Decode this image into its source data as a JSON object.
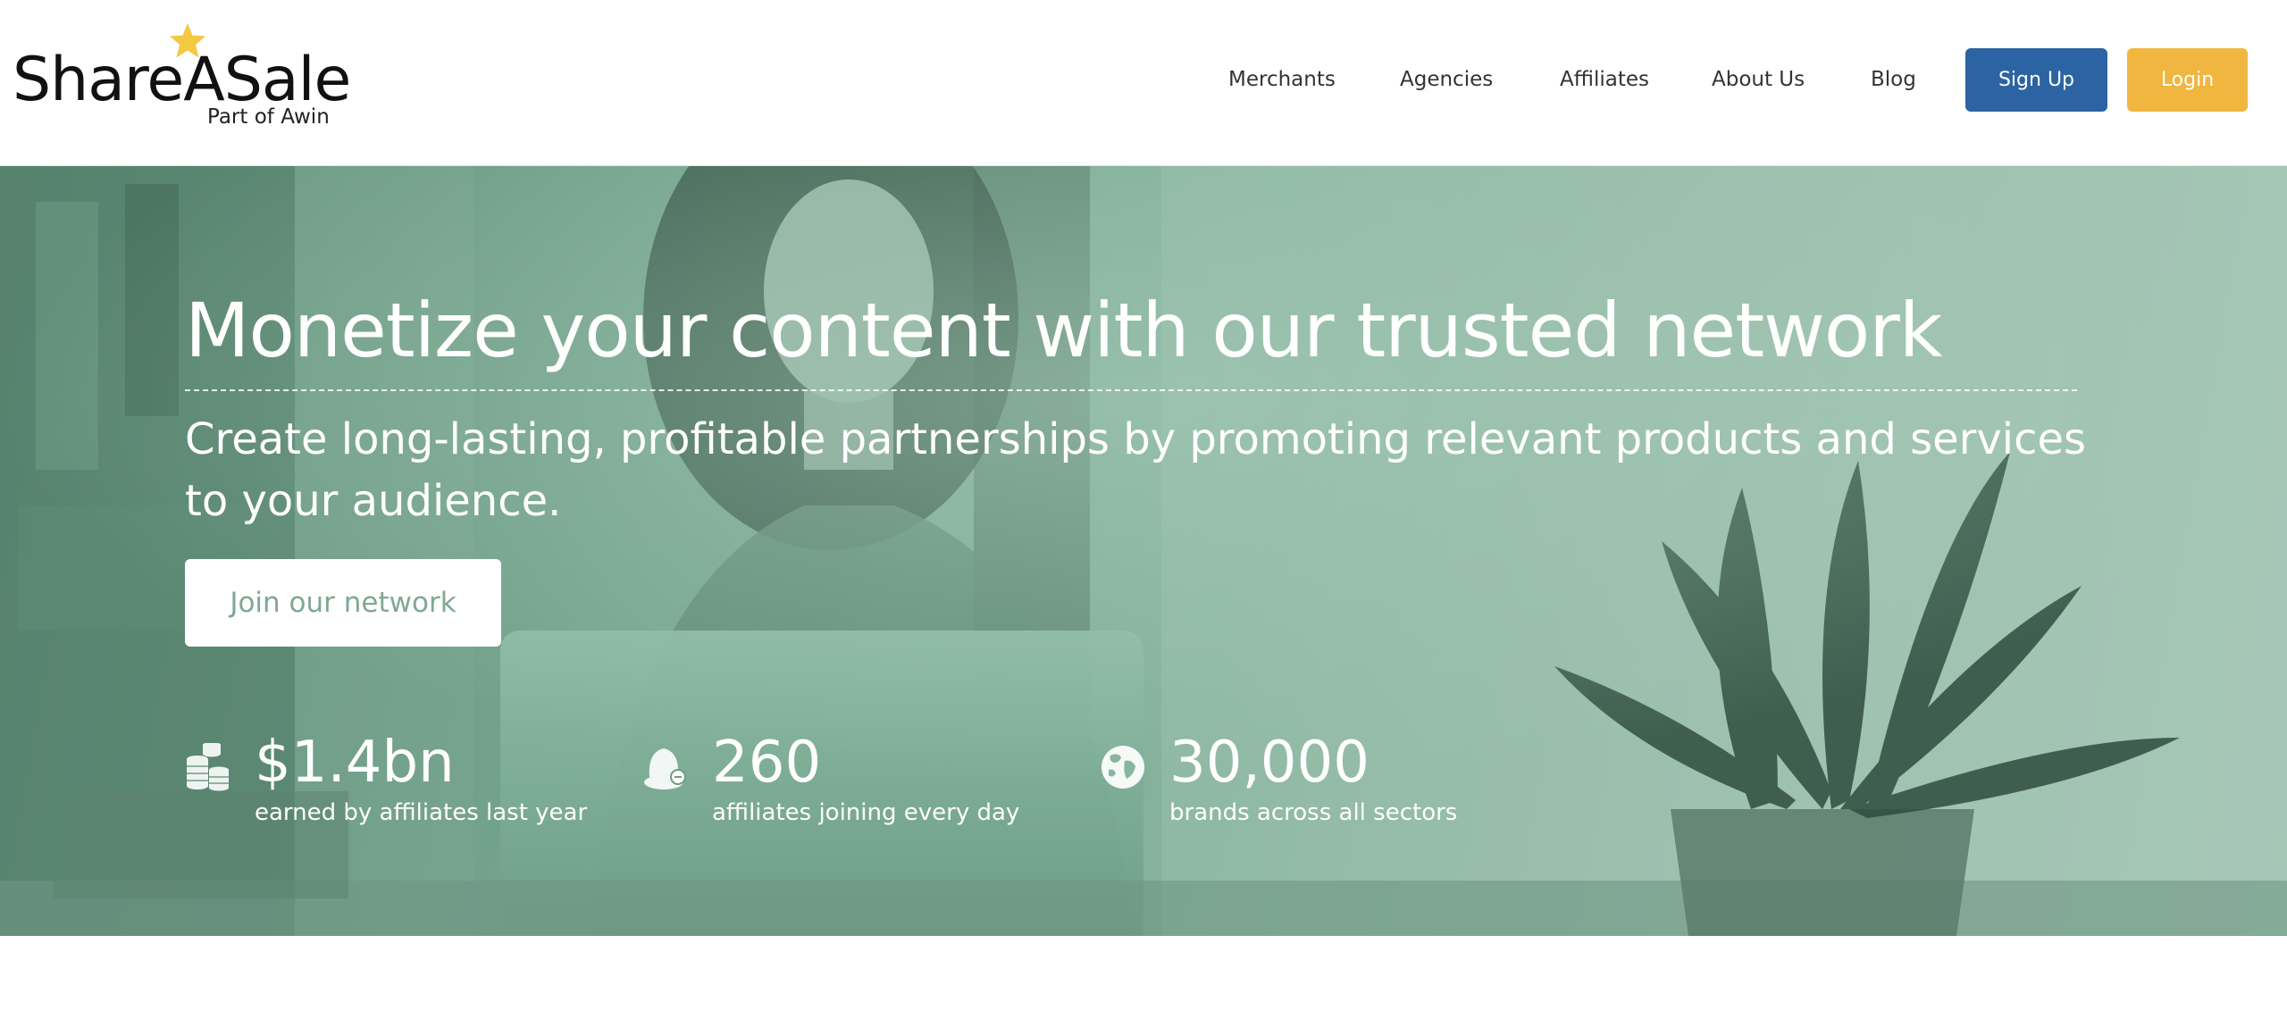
{
  "brand": {
    "name": "ShareASale",
    "tagline": "Part of Awin",
    "star_color": "#f5c842"
  },
  "nav": {
    "items": [
      {
        "label": "Merchants"
      },
      {
        "label": "Agencies"
      },
      {
        "label": "Affiliates"
      },
      {
        "label": "About Us"
      },
      {
        "label": "Blog"
      }
    ],
    "signup_label": "Sign Up",
    "login_label": "Login"
  },
  "colors": {
    "signup_blue": "#2c64a3",
    "login_yellow": "#f0b63f",
    "hero_green": "#7fa893"
  },
  "hero": {
    "title": "Monetize your content with our trusted network",
    "subtitle": "Create long-lasting, profitable partnerships by promoting relevant products and services to your audience.",
    "cta_label": "Join our network",
    "stats": [
      {
        "icon": "coins-icon",
        "value": "$1.4bn",
        "label": "earned by affiliates last year"
      },
      {
        "icon": "person-add-icon",
        "value": "260",
        "label": "affiliates joining every day"
      },
      {
        "icon": "globe-icon",
        "value": "30,000",
        "label": "brands across all sectors"
      }
    ]
  }
}
